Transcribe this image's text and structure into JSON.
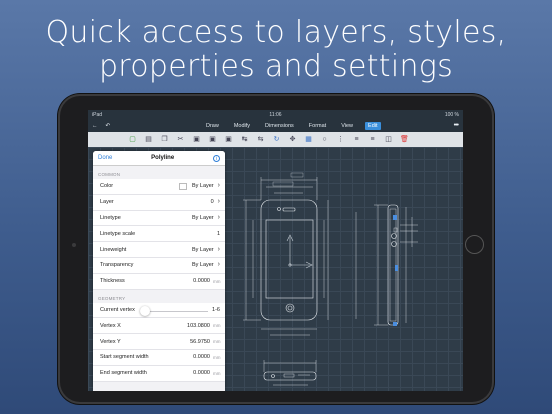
{
  "headline": {
    "line1": "Quick access to layers, styles,",
    "line2": "properties and settings"
  },
  "statusbar": {
    "carrier": "iPad",
    "time": "11:06",
    "battery": "100 %"
  },
  "menubar": {
    "tabs": [
      {
        "label": "Draw",
        "active": false
      },
      {
        "label": "Modify",
        "active": false
      },
      {
        "label": "Dimensions",
        "active": false
      },
      {
        "label": "Format",
        "active": false
      },
      {
        "label": "View",
        "active": false
      },
      {
        "label": "Edit",
        "active": true
      }
    ],
    "more_label": "•••"
  },
  "toolbar": {
    "tools": [
      "select-icon",
      "properties-icon",
      "copy-icon",
      "cut-icon",
      "paste-icon",
      "paste-icon",
      "paste-icon",
      "dimension-icon",
      "move-icon",
      "rotate-icon",
      "move-icon",
      "scale-icon",
      "circle-icon",
      "array-icon",
      "stack-icon",
      "stack-icon",
      "stack-icon",
      "stack-icon",
      "delete-icon"
    ]
  },
  "panel": {
    "done_label": "Done",
    "title": "Polyline",
    "info_label": "i",
    "common_header": "COMMON",
    "common_rows": [
      {
        "label": "Color",
        "value": "By Layer",
        "chevron": true
      },
      {
        "label": "Layer",
        "value": "0",
        "chevron": true
      },
      {
        "label": "Linetype",
        "value": "By Layer",
        "chevron": true
      },
      {
        "label": "Linetype scale",
        "value": "1"
      },
      {
        "label": "Lineweight",
        "value": "By Layer",
        "chevron": true
      },
      {
        "label": "Transparency",
        "value": "By Layer",
        "chevron": true
      },
      {
        "label": "Thickness",
        "value": "0.0000",
        "unit": "mm"
      }
    ],
    "geometry_header": "GEOMETRY",
    "current_vertex": {
      "label": "Current vertex",
      "value": "1-6"
    },
    "geometry_rows": [
      {
        "label": "Vertex X",
        "value": "103.0800",
        "unit": "mm"
      },
      {
        "label": "Vertex Y",
        "value": "56.9750",
        "unit": "mm"
      },
      {
        "label": "Start segment width",
        "value": "0.0000",
        "unit": "mm"
      },
      {
        "label": "End segment width",
        "value": "0.0000",
        "unit": "mm"
      }
    ]
  },
  "colors": {
    "accent": "#2f7fd8",
    "active_tab": "#3a8fdc",
    "canvas": "#2f3c48",
    "drawing_lines": "#e8ecf0"
  }
}
